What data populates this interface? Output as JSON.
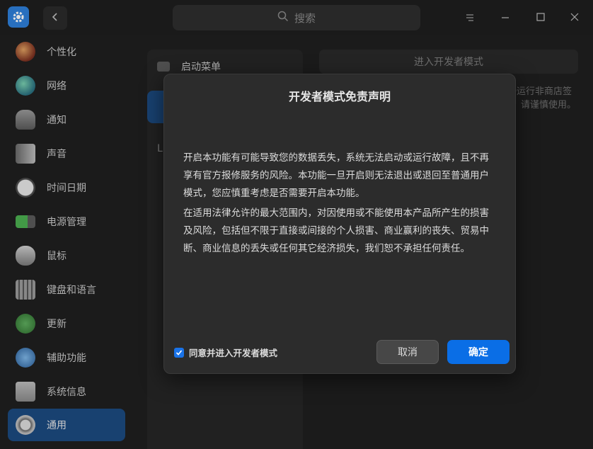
{
  "titlebar": {
    "search_placeholder": "搜索",
    "icons": [
      "settings-app-icon",
      "back-icon",
      "search-icon",
      "menu-icon",
      "minimize-icon",
      "maximize-icon",
      "close-icon"
    ]
  },
  "sidebar": {
    "items": [
      {
        "label": "个性化",
        "icon": "personalization-icon"
      },
      {
        "label": "网络",
        "icon": "network-icon"
      },
      {
        "label": "通知",
        "icon": "bell-icon"
      },
      {
        "label": "声音",
        "icon": "speaker-icon"
      },
      {
        "label": "时间日期",
        "icon": "clock-icon"
      },
      {
        "label": "电源管理",
        "icon": "battery-icon"
      },
      {
        "label": "鼠标",
        "icon": "mouse-icon"
      },
      {
        "label": "键盘和语言",
        "icon": "keyboard-icon"
      },
      {
        "label": "更新",
        "icon": "update-icon"
      },
      {
        "label": "辅助功能",
        "icon": "accessibility-icon"
      },
      {
        "label": "系统信息",
        "icon": "system-info-icon"
      },
      {
        "label": "通用",
        "icon": "general-icon"
      }
    ],
    "active_index": 11
  },
  "middle": {
    "boot_menu_label": "启动菜单",
    "partial_label": "L"
  },
  "right": {
    "dev_mode_button": "进入开发者模式",
    "hint_line1": "D运行非商店签",
    "hint_line2": "请谨慎使用。"
  },
  "dialog": {
    "title": "开发者模式免责声明",
    "para1": "开启本功能有可能导致您的数据丢失，系统无法启动或运行故障，且不再享有官方报修服务的风险。本功能一旦开启则无法退出或退回至普通用户模式，您应慎重考虑是否需要开启本功能。",
    "para2": "在适用法律允许的最大范围内，对因使用或不能使用本产品所产生的损害及风险，包括但不限于直接或间接的个人损害、商业赢利的丧失、贸易中断、商业信息的丢失或任何其它经济损失，我们恕不承担任何责任。",
    "agree_label": "同意并进入开发者模式",
    "agree_checked": true,
    "cancel_label": "取消",
    "ok_label": "确定"
  },
  "colors": {
    "accent": "#0a6ee6",
    "sidebar_active": "#1c4a80",
    "background": "#1f1f1f",
    "dialog_bg": "#2c2c2c"
  }
}
